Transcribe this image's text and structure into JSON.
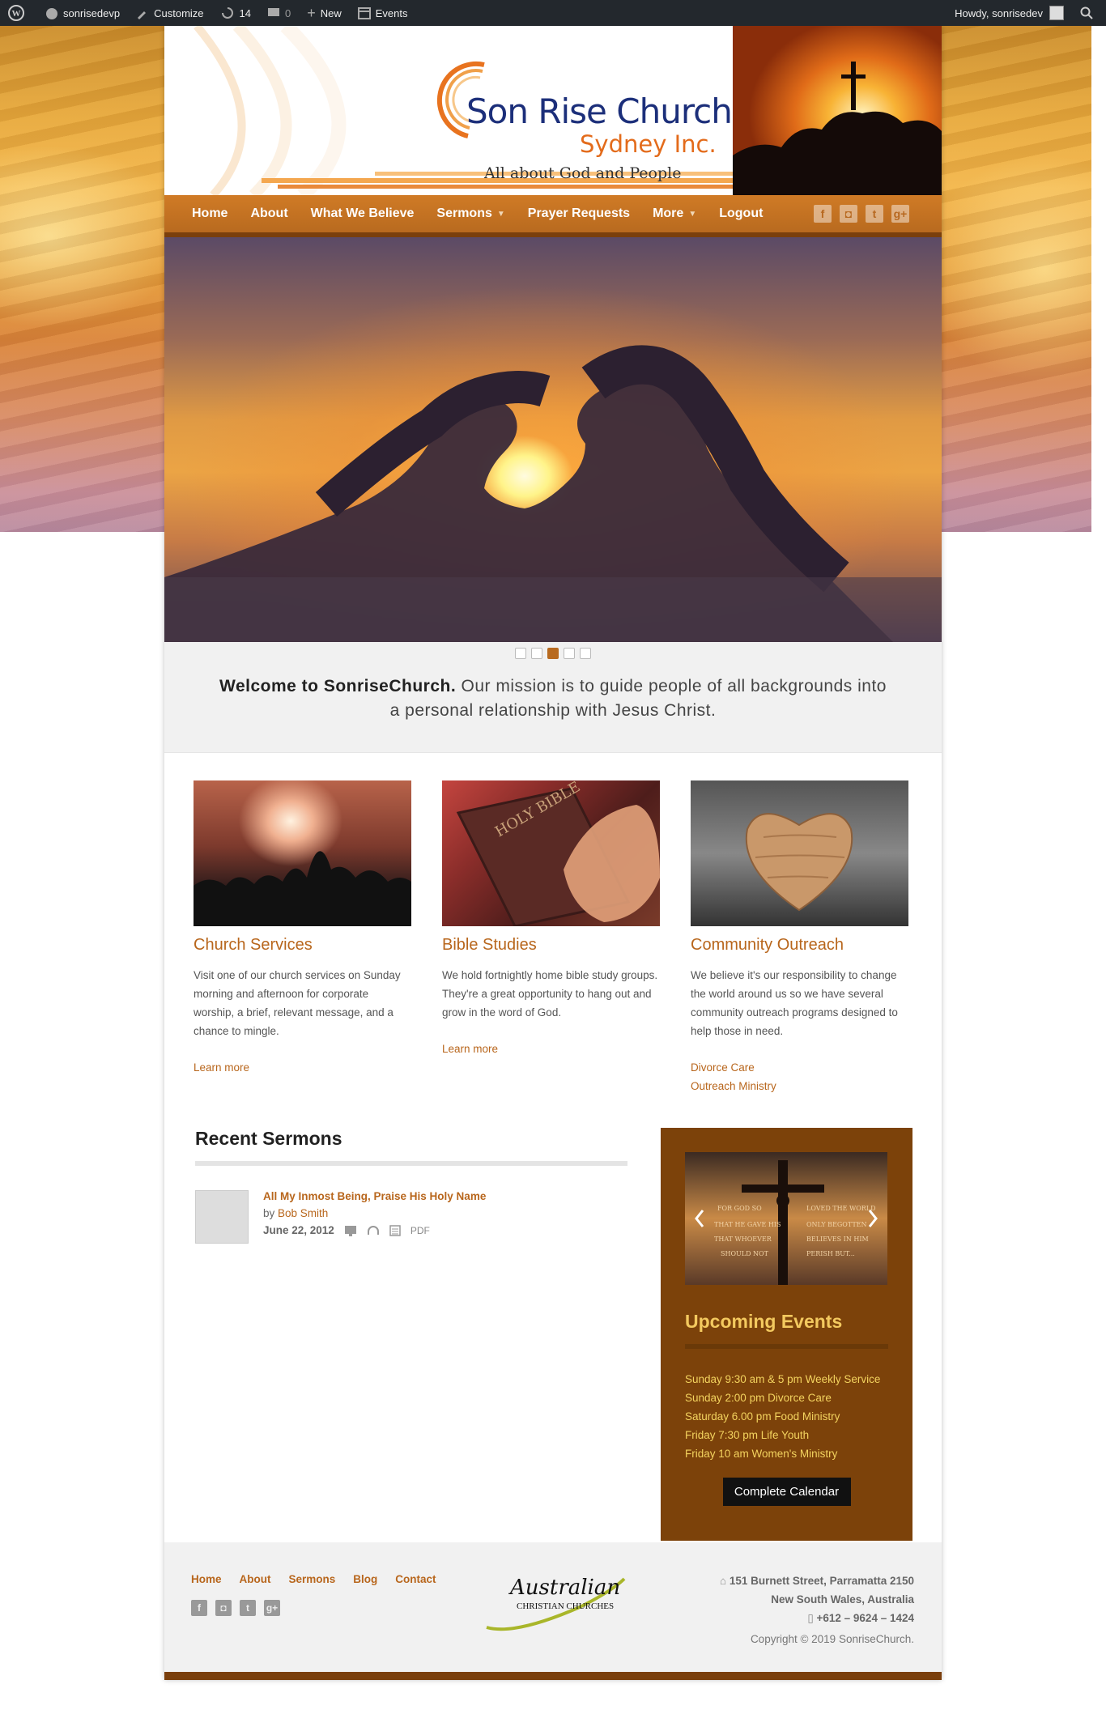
{
  "adminbar": {
    "site": "sonrisedevp",
    "customize": "Customize",
    "updates": "14",
    "comments": "0",
    "new": "New",
    "events": "Events",
    "howdy": "Howdy, sonrisedev"
  },
  "header": {
    "logo_line1": "Son Rise Church",
    "logo_line2": "Sydney Inc.",
    "tagline": "All about God and People"
  },
  "nav": {
    "items": [
      "Home",
      "About",
      "What We Believe",
      "Sermons",
      "Prayer Requests",
      "More",
      "Logout"
    ],
    "social": [
      "facebook-icon",
      "instagram-icon",
      "twitter-icon",
      "googleplus-icon"
    ]
  },
  "slider": {
    "dots": 5,
    "active": 3
  },
  "welcome": {
    "bold": "Welcome to SonriseChurch.",
    "text": " Our mission is to guide people of all backgrounds into a personal relationship with Jesus Christ."
  },
  "features": [
    {
      "title": "Church Services",
      "text": "Visit one of our church services on Sunday morning and afternoon for corporate worship, a brief, relevant message, and a chance to mingle.",
      "links": [
        "Learn more"
      ]
    },
    {
      "title": "Bible Studies",
      "text": "We hold fortnightly home bible study groups. They're a great opportunity to hang out and grow in the word of God.",
      "links": [
        "Learn more"
      ]
    },
    {
      "title": "Community Outreach",
      "text": "We believe it's our responsibility to change the world around us so we have several community outreach programs designed to help those in need.",
      "links": [
        "Divorce Care",
        "Outreach Ministry"
      ]
    }
  ],
  "sermons": {
    "heading": "Recent Sermons",
    "item": {
      "title": "All My Inmost Being, Praise His Holy Name",
      "by": "by ",
      "author": "Bob Smith",
      "date": "June 22, 2012",
      "pdf": "PDF"
    }
  },
  "events": {
    "heading": "Upcoming Events",
    "items": [
      "Sunday 9:30 am & 5 pm Weekly Service",
      "Sunday 2:00 pm Divorce Care",
      "Saturday 6.00 pm Food Ministry",
      "Friday 7:30 pm Life Youth",
      "Friday 10 am Women's Ministry"
    ],
    "button": "Complete Calendar",
    "banner_words": [
      "FOR GOD SO",
      "LOVED THE WORLD",
      "THAT HE GAVE HIS",
      "ONLY BEGOTTEN",
      "THAT WHOEVER",
      "BELIEVES IN HIM",
      "SHOULD NOT",
      "PERISH BUT..."
    ]
  },
  "footer": {
    "nav": [
      "Home",
      "About",
      "Sermons",
      "Blog",
      "Contact"
    ],
    "acc_line1": "Australian",
    "acc_line2": "CHRISTIAN CHURCHES",
    "address1": "151 Burnett Street, Parramatta 2150",
    "address2": "New South Wales, Australia",
    "phone": "+612 – 9624 – 1424",
    "copyright": "Copyright © 2019 SonriseChurch."
  },
  "colors": {
    "accent": "#b8661c",
    "nav": "#c8742a",
    "events_bg": "#7c420a",
    "events_text": "#f3d35f",
    "admin_bar": "#23282d"
  }
}
